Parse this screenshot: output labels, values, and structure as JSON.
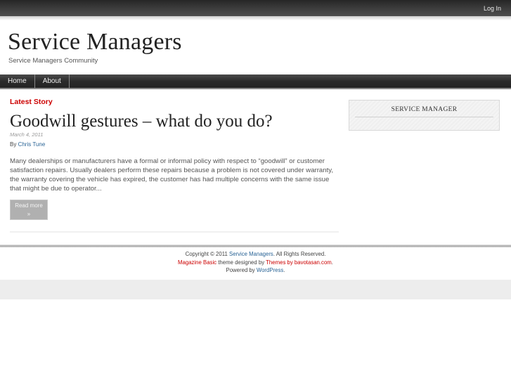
{
  "topbar": {
    "login_label": "Log In"
  },
  "header": {
    "site_title": "Service Managers",
    "tagline": "Service Managers Community"
  },
  "nav": {
    "items": [
      {
        "label": "Home"
      },
      {
        "label": "About"
      }
    ]
  },
  "main": {
    "section_label": "Latest Story",
    "post": {
      "title": "Goodwill gestures – what do you do?",
      "date": "March 4, 2011",
      "by_prefix": "By",
      "author": "Chris Tune",
      "excerpt": "Many dealerships or manufacturers have a formal or informal policy with respect to “goodwill” or customer satisfaction repairs. Usually dealers perform these repairs because a problem is not covered under warranty, the warranty covering the vehicle has expired, the customer has had multiple concerns with the same issue that might be due to operator...",
      "read_more_label": "Read more",
      "read_more_arrow": "»"
    }
  },
  "sidebar": {
    "widget_title": "SERVICE MANAGER"
  },
  "footer": {
    "line1_prefix": "Copyright © 2011",
    "line1_link": "Service Managers",
    "line1_suffix": ". All Rights Reserved.",
    "line2_link1": "Magazine Basic",
    "line2_middle": "theme designed by",
    "line2_link2": "Themes by bavotasan.com",
    "line2_suffix": ".",
    "line3_prefix": "Powered by",
    "line3_link": "WordPress",
    "line3_suffix": "."
  },
  "colors": {
    "accent_red": "#cc0000",
    "link_blue": "#2a6496",
    "nav_dark": "#2b2b2b"
  }
}
